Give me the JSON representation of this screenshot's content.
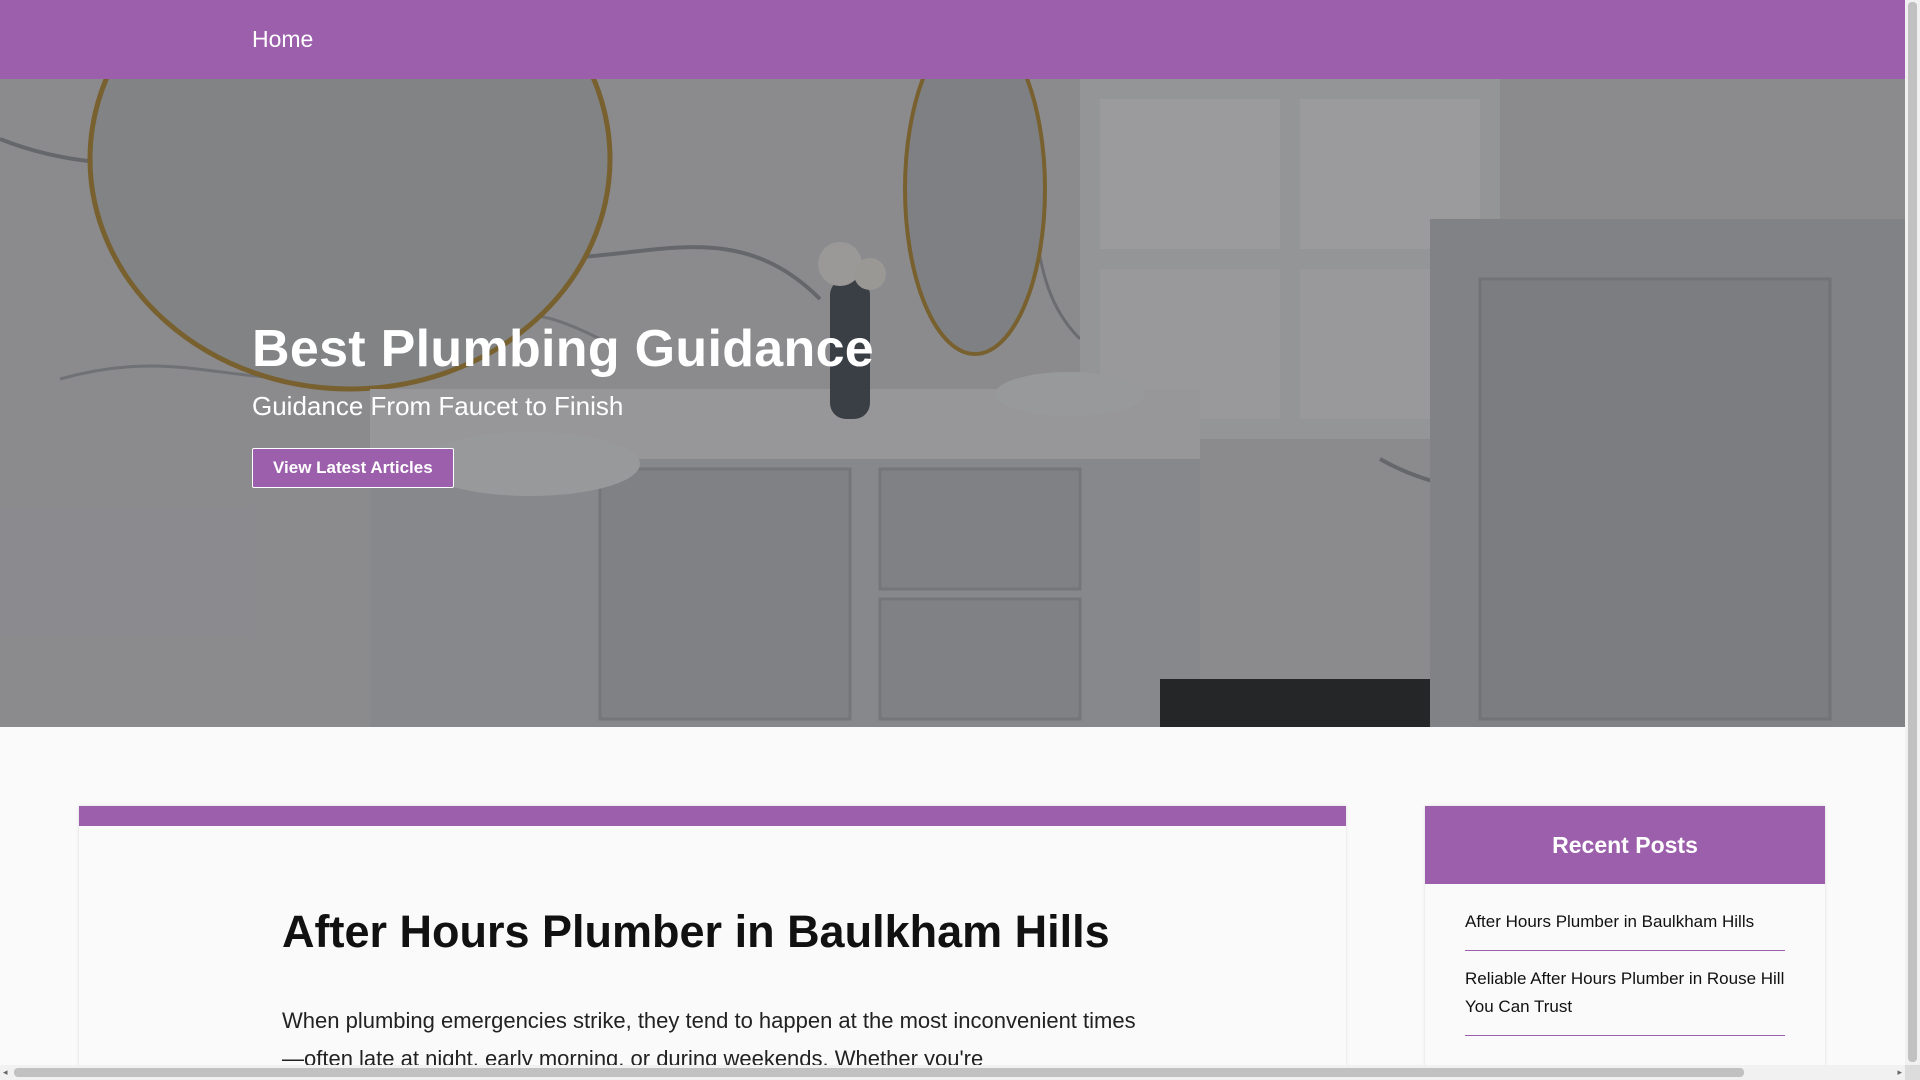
{
  "colors": {
    "accent": "#9c5fab",
    "background": "#fafafa",
    "text": "#111111",
    "white": "#ffffff"
  },
  "nav": {
    "home_label": "Home"
  },
  "hero": {
    "title": "Best Plumbing Guidance",
    "subtitle": "Guidance From Faucet to Finish",
    "cta_label": "View Latest Articles",
    "image_description_icon": "bathroom-photo"
  },
  "article": {
    "title": "After Hours Plumber in Baulkham Hills",
    "intro": "When plumbing emergencies strike, they tend to happen at the most inconvenient times—often late at night, early morning, or during weekends. Whether you're"
  },
  "sidebar": {
    "title": "Recent Posts",
    "posts": [
      "After Hours Plumber in Baulkham Hills",
      "Reliable After Hours Plumber in Rouse Hill You Can Trust"
    ]
  },
  "scrollbars": {
    "arrow_left": "◂",
    "arrow_right": "▸"
  }
}
